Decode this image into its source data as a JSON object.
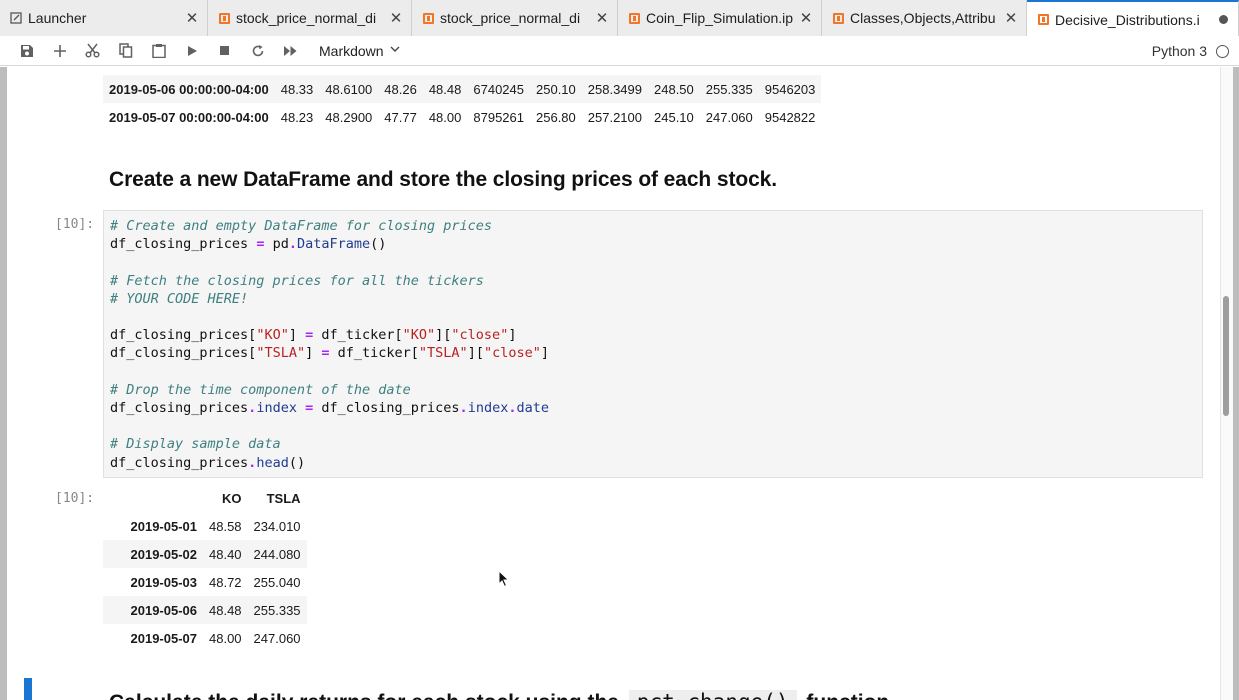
{
  "tabs": [
    {
      "label": "Launcher",
      "icon": "launcher-icon",
      "suffix": "close"
    },
    {
      "label": "stock_price_normal_di",
      "icon": "notebook-icon",
      "suffix": "close"
    },
    {
      "label": "stock_price_normal_di",
      "icon": "notebook-icon",
      "suffix": "close"
    },
    {
      "label": "Coin_Flip_Simulation.ip",
      "icon": "notebook-icon",
      "suffix": "close"
    },
    {
      "label": "Classes,Objects,Attribu",
      "icon": "notebook-icon",
      "suffix": "close"
    },
    {
      "label": "Decisive_Distributions.i",
      "icon": "notebook-icon",
      "suffix": "unsaved-dot",
      "active": true
    }
  ],
  "toolbar": {
    "buttons": [
      "save-icon",
      "add-cell-icon",
      "cut-icon",
      "copy-icon",
      "paste-icon",
      "run-icon",
      "stop-icon",
      "restart-icon",
      "fast-forward-icon"
    ],
    "cell_type": "Markdown",
    "kernel": "Python 3"
  },
  "previous_output": {
    "rows": [
      {
        "index": "2019-05-06 00:00:00-04:00",
        "values": [
          "48.33",
          "48.6100",
          "48.26",
          "48.48",
          "6740245",
          "250.10",
          "258.3499",
          "248.50",
          "255.335",
          "9546203"
        ]
      },
      {
        "index": "2019-05-07 00:00:00-04:00",
        "values": [
          "48.23",
          "48.2900",
          "47.77",
          "48.00",
          "8795261",
          "256.80",
          "257.2100",
          "245.10",
          "247.060",
          "9542822"
        ]
      }
    ]
  },
  "markdown_heading": "Create a new DataFrame and store the closing prices of each stock.",
  "code_cell": {
    "prompt": "[10]:",
    "lines": [
      "# Create and empty DataFrame for closing prices",
      "df_closing_prices = pd.DataFrame()",
      "",
      "# Fetch the closing prices for all the tickers",
      "# YOUR CODE HERE!",
      "",
      "df_closing_prices[\"KO\"] = df_ticker[\"KO\"][\"close\"]",
      "df_closing_prices[\"TSLA\"] = df_ticker[\"TSLA\"][\"close\"]",
      "",
      "# Drop the time component of the date",
      "df_closing_prices.index = df_closing_prices.index.date",
      "",
      "# Display sample data",
      "df_closing_prices.head()"
    ]
  },
  "output_cell": {
    "prompt": "[10]:",
    "columns": [
      "",
      "KO",
      "TSLA"
    ],
    "rows": [
      {
        "date": "2019-05-01",
        "KO": "48.58",
        "TSLA": "234.010"
      },
      {
        "date": "2019-05-02",
        "KO": "48.40",
        "TSLA": "244.080"
      },
      {
        "date": "2019-05-03",
        "KO": "48.72",
        "TSLA": "255.040"
      },
      {
        "date": "2019-05-06",
        "KO": "48.48",
        "TSLA": "255.335"
      },
      {
        "date": "2019-05-07",
        "KO": "48.00",
        "TSLA": "247.060"
      }
    ]
  },
  "next_markdown": {
    "before": "Calculate the daily returns for each stock using the",
    "code": "pct_change()",
    "after": "function"
  }
}
